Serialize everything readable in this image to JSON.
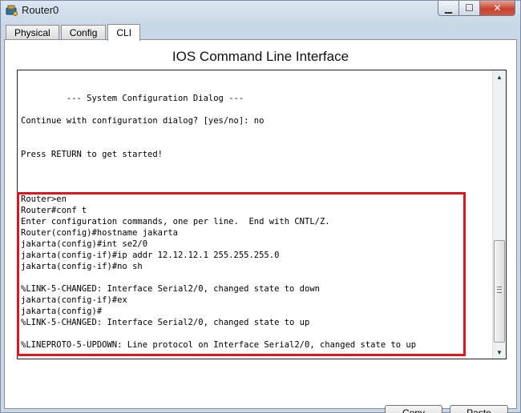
{
  "window": {
    "title": "Router0",
    "controls": {
      "minimize": "▁",
      "maximize": "☐",
      "close": "✕"
    }
  },
  "tabs": [
    {
      "label": "Physical",
      "active": false
    },
    {
      "label": "Config",
      "active": false
    },
    {
      "label": "CLI",
      "active": true
    }
  ],
  "panel": {
    "title": "IOS Command Line Interface"
  },
  "terminal": {
    "lines": [
      "",
      "",
      "         --- System Configuration Dialog ---",
      "",
      "Continue with configuration dialog? [yes/no]: no",
      "",
      "",
      "Press RETURN to get started!",
      "",
      "",
      "",
      "Router>en",
      "Router#conf t",
      "Enter configuration commands, one per line.  End with CNTL/Z.",
      "Router(config)#hostname jakarta",
      "jakarta(config)#int se2/0",
      "jakarta(config-if)#ip addr 12.12.12.1 255.255.255.0",
      "jakarta(config-if)#no sh",
      "",
      "%LINK-5-CHANGED: Interface Serial2/0, changed state to down",
      "jakarta(config-if)#ex",
      "jakarta(config)#",
      "%LINK-5-CHANGED: Interface Serial2/0, changed state to up",
      "",
      "%LINEPROTO-5-UPDOWN: Line protocol on Interface Serial2/0, changed state to up",
      ""
    ]
  },
  "buttons": {
    "copy": "Copy",
    "paste": "Paste"
  },
  "colors": {
    "highlight": "#e0161e",
    "close_button": "#c8452f"
  },
  "icons": {
    "app": "router-app-icon",
    "scroll_up": "scroll-up-arrow-icon",
    "scroll_down": "scroll-down-arrow-icon"
  }
}
